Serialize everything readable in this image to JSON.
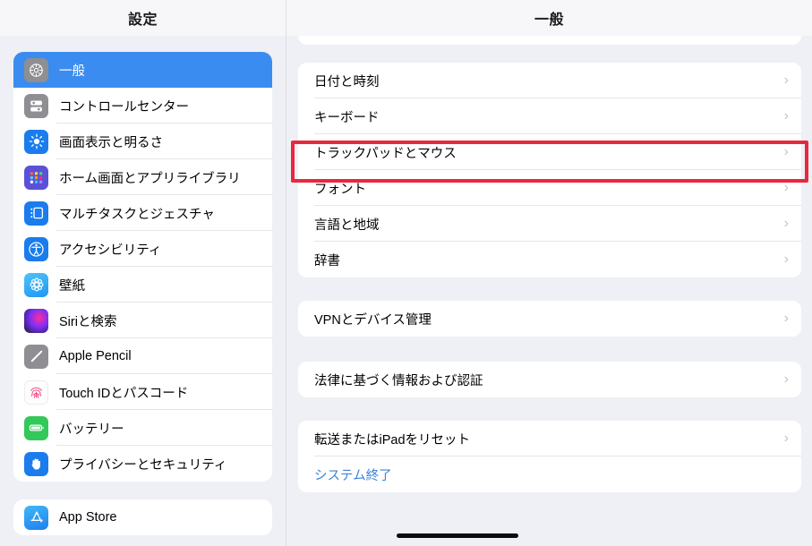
{
  "header": {
    "sidebar_title": "設定",
    "detail_title": "一般"
  },
  "sidebar": {
    "groups": [
      {
        "items": [
          {
            "label": "一般",
            "icon": "gear-icon",
            "selected": true
          },
          {
            "label": "コントロールセンター",
            "icon": "control-center-icon",
            "selected": false
          },
          {
            "label": "画面表示と明るさ",
            "icon": "brightness-icon",
            "selected": false
          },
          {
            "label": "ホーム画面とアプリライブラリ",
            "icon": "home-screen-icon",
            "selected": false
          },
          {
            "label": "マルチタスクとジェスチャ",
            "icon": "multitasking-icon",
            "selected": false
          },
          {
            "label": "アクセシビリティ",
            "icon": "accessibility-icon",
            "selected": false
          },
          {
            "label": "壁紙",
            "icon": "wallpaper-icon",
            "selected": false
          },
          {
            "label": "Siriと検索",
            "icon": "siri-icon",
            "selected": false
          },
          {
            "label": "Apple Pencil",
            "icon": "pencil-icon",
            "selected": false
          },
          {
            "label": "Touch IDとパスコード",
            "icon": "touch-id-icon",
            "selected": false
          },
          {
            "label": "バッテリー",
            "icon": "battery-icon",
            "selected": false
          },
          {
            "label": "プライバシーとセキュリティ",
            "icon": "privacy-hand-icon",
            "selected": false
          }
        ]
      },
      {
        "items": [
          {
            "label": "App Store",
            "icon": "app-store-icon",
            "selected": false
          }
        ]
      }
    ]
  },
  "detail": {
    "groups": [
      {
        "rows": [
          {
            "label": "日付と時刻",
            "chevron": "›",
            "link": false
          },
          {
            "label": "キーボード",
            "chevron": "›",
            "link": false
          },
          {
            "label": "トラックパッドとマウス",
            "chevron": "›",
            "link": false,
            "highlighted": true
          },
          {
            "label": "フォント",
            "chevron": "›",
            "link": false
          },
          {
            "label": "言語と地域",
            "chevron": "›",
            "link": false
          },
          {
            "label": "辞書",
            "chevron": "›",
            "link": false
          }
        ]
      },
      {
        "rows": [
          {
            "label": "VPNとデバイス管理",
            "chevron": "›",
            "link": false
          }
        ]
      },
      {
        "rows": [
          {
            "label": "法律に基づく情報および認証",
            "chevron": "›",
            "link": false
          }
        ]
      },
      {
        "rows": [
          {
            "label": "転送またはiPadをリセット",
            "chevron": "›",
            "link": false
          },
          {
            "label": "システム終了",
            "chevron": "",
            "link": true
          }
        ]
      }
    ]
  },
  "annotation": {
    "target_label": "トラックパッドとマウス",
    "box_color": "#e8283f"
  },
  "colors": {
    "selection_blue": "#3b8cf0",
    "link_blue": "#3b82d8",
    "background": "#eef0f5",
    "card": "#ffffff"
  }
}
